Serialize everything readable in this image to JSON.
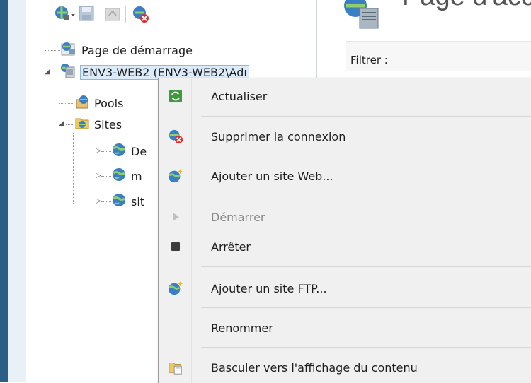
{
  "tree": {
    "nodes": [
      {
        "label": "Page de démarrage"
      },
      {
        "label": "ENV3-WEB2 (ENV3-WEB2\\Adı"
      },
      {
        "label": "Pools"
      },
      {
        "label": "Sites"
      },
      {
        "label": "De"
      },
      {
        "label": "m"
      },
      {
        "label": "sit"
      }
    ]
  },
  "right_pane": {
    "title": "Page d'acc",
    "filter_label": "Filtrer :"
  },
  "context_menu": {
    "items": [
      {
        "label": "Actualiser",
        "icon": "refresh-icon"
      },
      {
        "label": "Supprimer la connexion",
        "icon": "remove-connection-icon"
      },
      {
        "label": "Ajouter un site Web...",
        "icon": "add-website-icon"
      },
      {
        "label": "Démarrer",
        "icon": "play-icon",
        "disabled": true
      },
      {
        "label": "Arrêter",
        "icon": "stop-icon"
      },
      {
        "label": "Ajouter un site FTP...",
        "icon": "add-ftp-site-icon"
      },
      {
        "label": "Renommer",
        "icon": ""
      },
      {
        "label": "Basculer vers l'affichage du contenu",
        "icon": "content-view-icon"
      }
    ]
  },
  "colors": {
    "menu_bg": "#f0f0f0",
    "selection": "#dcebfa",
    "accent_blue": "#2b5f86"
  }
}
